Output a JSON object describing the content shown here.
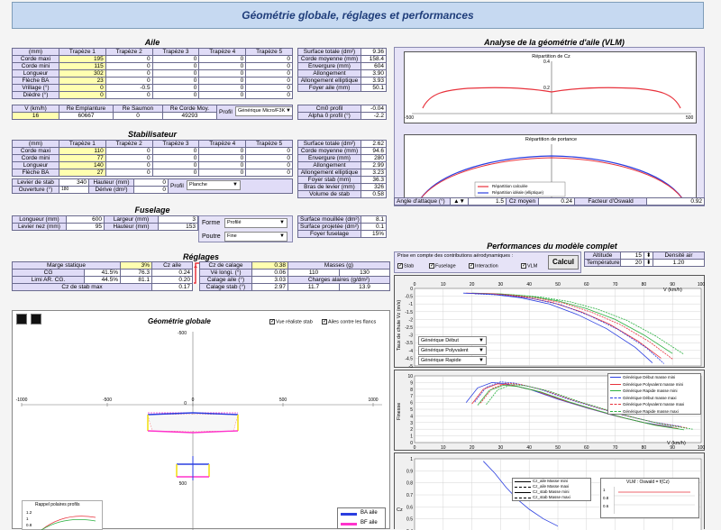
{
  "title": "Géométrie globale, réglages et performances",
  "aile": {
    "title": "Aile",
    "head": [
      "(mm)",
      "Trapèze 1",
      "Trapèze 2",
      "Trapèze 3",
      "Trapèze 4",
      "Trapèze 5"
    ],
    "rows": [
      {
        "l": "Corde maxi",
        "v": [
          "195",
          "0",
          "0",
          "0",
          "0"
        ]
      },
      {
        "l": "Corde mini",
        "v": [
          "115",
          "0",
          "0",
          "0",
          "0"
        ]
      },
      {
        "l": "Longueur",
        "v": [
          "302",
          "0",
          "0",
          "0",
          "0"
        ]
      },
      {
        "l": "Flèche BA",
        "v": [
          "23",
          "0",
          "0",
          "0",
          "0"
        ]
      },
      {
        "l": "Vrillage (°)",
        "v": [
          "0",
          "-0.5",
          "0",
          "0",
          "0"
        ]
      },
      {
        "l": "Dièdre (°)",
        "v": [
          "0",
          "0",
          "0",
          "0",
          "0"
        ]
      }
    ],
    "v_label": "V (km/h)",
    "v_val": "16",
    "re_emp_label": "Re Emplanture",
    "re_emp": "60667",
    "re_sau_label": "Re Saumon",
    "re_sau": "0",
    "re_moy_label": "Re Corde Moy.",
    "re_moy": "49293",
    "profil_label": "Profil",
    "profil": "Générique Micro/F3K",
    "res": [
      [
        "Surface totale (dm²)",
        "9.36"
      ],
      [
        "Corde moyenne (mm)",
        "158.4"
      ],
      [
        "Envergure (mm)",
        "604"
      ],
      [
        "Allongement",
        "3.90"
      ],
      [
        "Allongement elliptique",
        "3.93"
      ],
      [
        "Foyer aile (mm)",
        "50.1"
      ]
    ],
    "res2": [
      [
        "Cm0 profil",
        "-0.04"
      ],
      [
        "Alpha 0 profil (°)",
        "-2.2"
      ]
    ]
  },
  "stab": {
    "title": "Stabilisateur",
    "head": [
      "(mm)",
      "Trapèze 1",
      "Trapèze 2",
      "Trapèze 3",
      "Trapèze 4",
      "Trapèze 5"
    ],
    "rows": [
      {
        "l": "Corde maxi",
        "v": [
          "110",
          "0",
          "0",
          "0",
          "0"
        ]
      },
      {
        "l": "Corde mini",
        "v": [
          "77",
          "0",
          "0",
          "0",
          "0"
        ]
      },
      {
        "l": "Longueur",
        "v": [
          "140",
          "0",
          "0",
          "0",
          "0"
        ]
      },
      {
        "l": "Flèche BA",
        "v": [
          "27",
          "0",
          "0",
          "0",
          "0"
        ]
      }
    ],
    "levier_label": "Levier de stab",
    "levier": "340",
    "hauteur_label": "Hauteur (mm)",
    "hauteur": "0",
    "ouverture_label": "Ouverture (°)",
    "ouverture": "180",
    "derive_label": "Dérive (dm²)",
    "derive": "0",
    "profil_label": "Profil",
    "profil": "Planche",
    "res": [
      [
        "Surface totale (dm²)",
        "2.62"
      ],
      [
        "Corde moyenne (mm)",
        "94.6"
      ],
      [
        "Envergure (mm)",
        "280"
      ],
      [
        "Allongement",
        "2.99"
      ],
      [
        "Allongement elliptique",
        "3.23"
      ],
      [
        "Foyer stab (mm)",
        "36.3"
      ],
      [
        "Bras de levier (mm)",
        "326"
      ],
      [
        "Volume de stab",
        "0.58"
      ]
    ]
  },
  "fus": {
    "title": "Fuselage",
    "rows": [
      [
        "Longueur (mm)",
        "600",
        "Largeur (mm)",
        "3"
      ],
      [
        "Levier nez (mm)",
        "95",
        "Hauteur (mm)",
        "153"
      ]
    ],
    "forme_label": "Forme",
    "forme": "Profilé",
    "poutre_label": "Poutre",
    "poutre": "Fine",
    "res": [
      [
        "Surface mouillée (dm²)",
        "8.1"
      ],
      [
        "Surface projetée (dm²)",
        "0.1"
      ],
      [
        "Foyer fuselage",
        "15%"
      ]
    ]
  },
  "reg": {
    "title": "Réglages",
    "ms_label": "Marge statique",
    "ms": "3%",
    "cz_aile_label": "Cz aile",
    "calage_label": "Cz de calage",
    "calage": "0.38",
    "cg_label": "CG",
    "cg_pct": "41.5%",
    "cg_mm": "76.3",
    "cz_aile": "0.24",
    "vel_label": "Vé longi. (°)",
    "vel": "0.06",
    "lim_label": "Limi AR. CG.",
    "lim_pct": "44.5%",
    "lim_mm": "81.1",
    "cz2": "0.20",
    "ca_label": "Calage aile (°)",
    "ca": "3.03",
    "czmax_label": "Cz de stab max",
    "czmax": "0.17",
    "cs_label": "Calage stab (°)",
    "cs": "2.97",
    "masses_label": "Masses (g)",
    "m1": "110",
    "m2": "130",
    "charges_label": "Charges alaires (g/dm²)",
    "c1": "11.7",
    "c2": "13.9"
  },
  "geo": {
    "title": "Géométrie globale",
    "cb1": "Vue réaliste stab",
    "cb2": "Ailes contre les flancs",
    "xt": [
      "-1000",
      "-500",
      "0",
      "500",
      "1000"
    ],
    "yt": [
      "-500",
      "0",
      "500"
    ],
    "leg": [
      "BA aile",
      "BF aile"
    ],
    "polar_title": "Rappel polaires profils",
    "py": [
      "1.2",
      "1",
      "0.8"
    ]
  },
  "vlm": {
    "title": "Analyse de la géométrie d'aile (VLM)",
    "p1": "Répartition de Cz",
    "p2": "Répartition de portance",
    "p2_leg": [
      "Répartition calculée",
      "Répartition idéale (elliptique)"
    ],
    "aoa_label": "Angle d'attaque (°)",
    "aoa": "1.5",
    "czm_label": "Cz moyen",
    "czm": "0.24",
    "osw_label": "Facteur d'Oswald",
    "osw": "0.92",
    "xt": [
      "-500",
      "0",
      "500"
    ],
    "p1y": [
      "0.4",
      "0.2",
      "0"
    ],
    "p2y": [
      "0"
    ]
  },
  "perf": {
    "title": "Performances du modèle complet",
    "prise": "Prise en compte des contributions aérodynamiques :",
    "chk": [
      "Stab",
      "Fuselage",
      "Interaction",
      "VLM"
    ],
    "calcul": "Calcul",
    "alt_label": "Altitude",
    "alt": "15",
    "dens_label": "Densité air",
    "dens": "1.20",
    "temp_label": "Température",
    "temp": "20",
    "xt": [
      "0",
      "10",
      "20",
      "30",
      "40",
      "50",
      "60",
      "70",
      "80",
      "90",
      "100"
    ],
    "vlab": "V (km/h)",
    "vzl": "Taux de chute Vz (m/s)",
    "vzy": [
      "0",
      "-0.5",
      "-1",
      "-1.5",
      "-2",
      "-2.5",
      "-3",
      "-3.5",
      "-4",
      "-4.5",
      "-5"
    ],
    "dd": [
      "Générique Début",
      "Générique Polyvalent",
      "Générique Rapide"
    ],
    "fin": "Finesse",
    "finy": [
      "10",
      "9",
      "8",
      "7",
      "6",
      "5",
      "4",
      "3",
      "2",
      "1",
      "0"
    ],
    "leg2": [
      "Générique Début masse mini",
      "Générique Polyvalent masse mini",
      "Générique Rapide masse mini",
      "Générique Début masse maxi",
      "Générique Polyvalent masse maxi",
      "Générique Rapide masse maxi"
    ],
    "czy": [
      "1",
      "0.9",
      "0.8",
      "0.7",
      "0.6",
      "0.5",
      "0.4"
    ],
    "cz": "Cz",
    "leg3": [
      "Cz_aile Masse mini",
      "Cz_aile Masse maxi",
      "Cz_stab Masse mini",
      "Cz_stab Masse maxi"
    ],
    "vlm_title": "VLM : Oswald = f(Cz)",
    "vlmy": [
      "1",
      "0.8",
      "0.6"
    ]
  },
  "colors": {
    "lav": "#e0dcf7",
    "yellow": "#ffffb0",
    "banner": "#c6d9f1",
    "red": "#e8323c",
    "blue": "#2a3ee0",
    "green": "#2ab040",
    "magenta": "#ff33cc",
    "yellowline": "#f2e01a"
  }
}
